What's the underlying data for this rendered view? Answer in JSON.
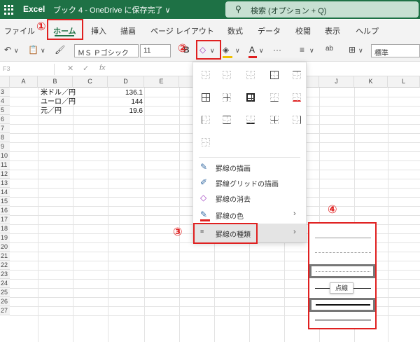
{
  "titlebar": {
    "app_name": "Excel",
    "doc_title": "ブック 4 - OneDrive に保存完了 ∨",
    "search_placeholder": "検索 (オプション + Q)"
  },
  "ribbon_tabs": [
    "ファイル",
    "ホーム",
    "挿入",
    "描画",
    "ページ レイアウト",
    "数式",
    "データ",
    "校閲",
    "表示",
    "ヘルプ"
  ],
  "toolbar": {
    "font_name": "ＭＳ Ｐゴシック",
    "font_size": "11",
    "number_format": "標準"
  },
  "formula_bar": {
    "name_box": "F3",
    "cancel": "✕",
    "confirm": "✓",
    "fx": "fx"
  },
  "columns": [
    "A",
    "B",
    "C",
    "D",
    "E",
    "F",
    "G",
    "H",
    "I",
    "J",
    "K",
    "L"
  ],
  "rows": [
    "3",
    "4",
    "5",
    "6",
    "7",
    "8",
    "9",
    "10",
    "11",
    "12",
    "13",
    "14",
    "15",
    "16",
    "17",
    "18",
    "19",
    "20",
    "21",
    "22",
    "23",
    "24",
    "25",
    "26",
    "27"
  ],
  "cells": [
    {
      "label": "米ドル／円",
      "value": "136.1"
    },
    {
      "label": "ユーロ／円",
      "value": "144"
    },
    {
      "label": "元／円",
      "value": "19.6"
    }
  ],
  "border_menu": {
    "items": [
      {
        "label": "罫線の描画",
        "icon": "draw-border-icon"
      },
      {
        "label": "罫線グリッドの描画",
        "icon": "draw-grid-icon"
      },
      {
        "label": "罫線の消去",
        "icon": "eraser-icon"
      },
      {
        "label": "罫線の色",
        "icon": "pen-color-icon",
        "chevron": "›"
      },
      {
        "label": "罫線の種類",
        "icon": "line-style-icon",
        "chevron": "›"
      }
    ]
  },
  "line_style_tooltip": "点線",
  "callouts": [
    "①",
    "②",
    "③",
    "④"
  ],
  "colors": {
    "excel_green": "#1e7145",
    "callout_red": "#e02020",
    "fill_yellow": "#f0c000",
    "font_red": "#e02020"
  }
}
